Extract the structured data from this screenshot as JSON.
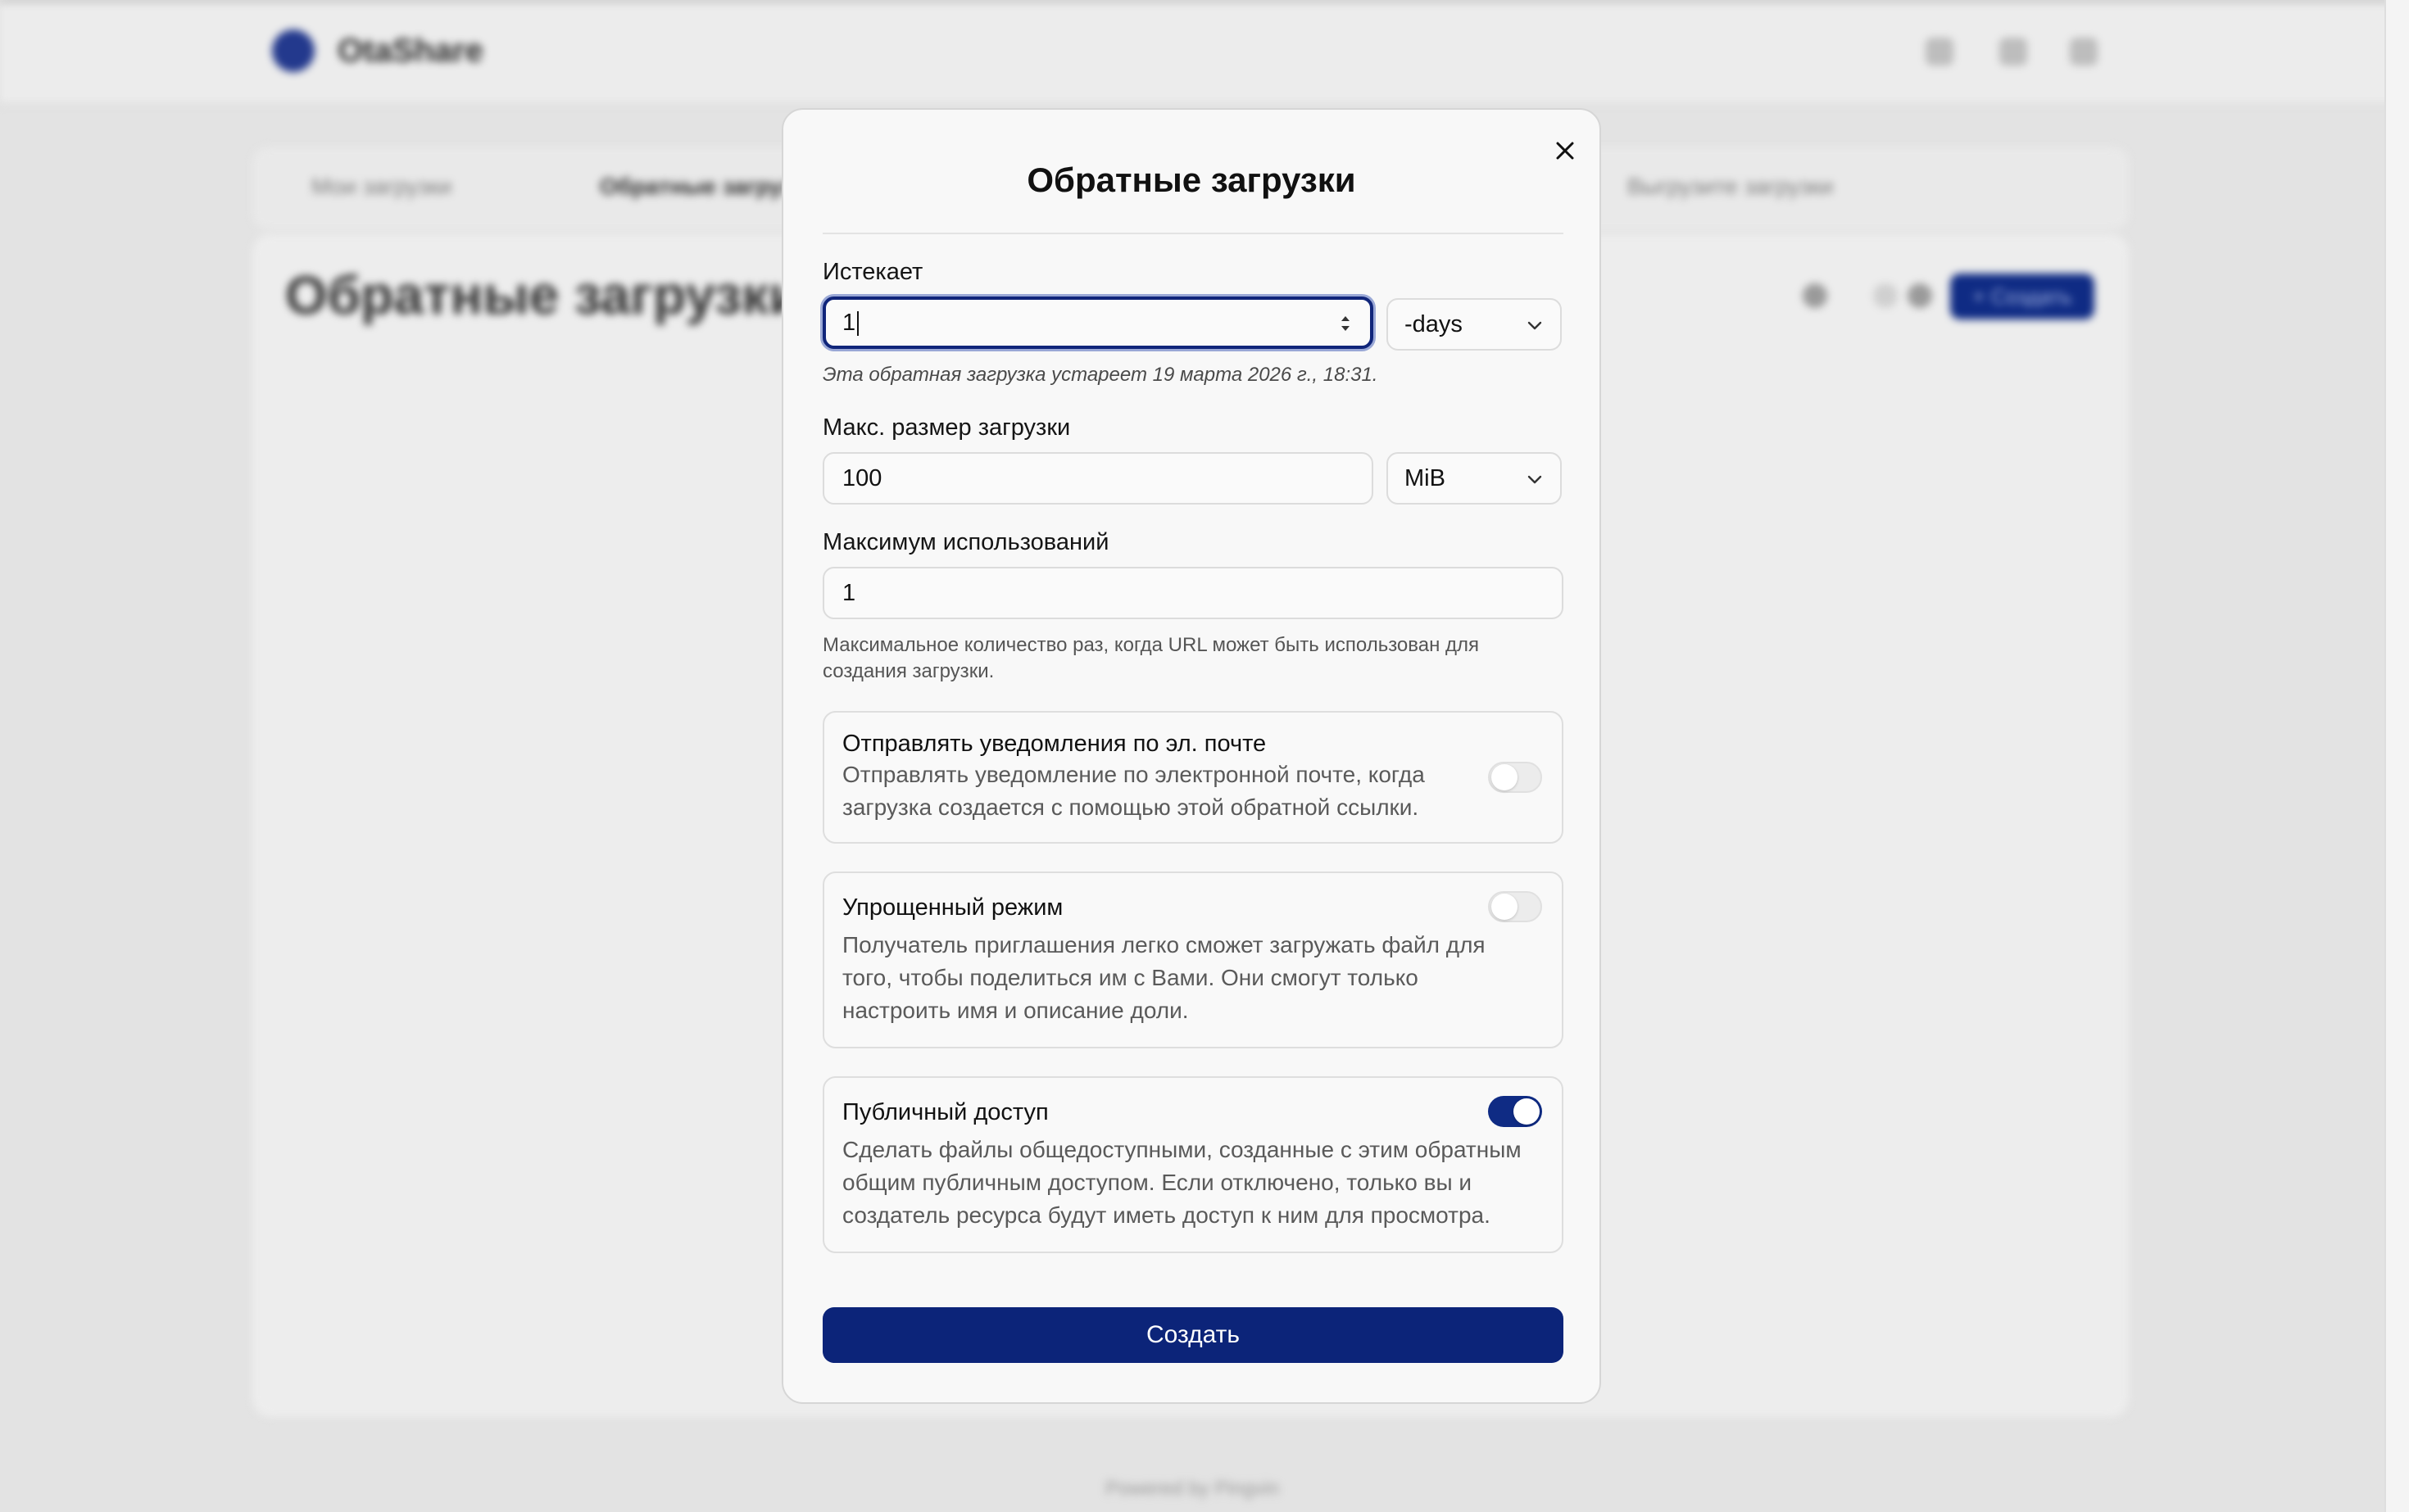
{
  "background": {
    "app_name": "OtaShare",
    "tabs": [
      "Мои загрузки",
      "Обратные загрузки",
      "Выгрузите загрузки"
    ],
    "page_title": "Обратные загрузки",
    "create_button": "+ Создать",
    "footer": "Powered by Pingvin"
  },
  "modal": {
    "title": "Обратные загрузки",
    "expires": {
      "label": "Истекает",
      "value": "1",
      "unit": "-days",
      "hint": "Эта обратная загрузка устарeет 19 марта 2026 г., 18:31."
    },
    "max_size": {
      "label": "Макс. размер загрузки",
      "value": "100",
      "unit": "MiB"
    },
    "max_uses": {
      "label": "Максимум использований",
      "value": "1",
      "hint_line1": "Максимальное количество раз, когда URL может быть использован для",
      "hint_line2": "создания загрузки."
    },
    "email_notify": {
      "title": "Отправлять уведомления по эл. почте",
      "desc_line1": "Отправлять уведомление по электронной почте, когда",
      "desc_line2": "загрузка создается с помощью этой обратной ссылки.",
      "enabled": false
    },
    "simple_mode": {
      "title": "Упрощенный режим",
      "desc_line1": "Получатель приглашения легко сможет загружать файл для",
      "desc_line2": "того, чтобы поделиться им с Вами. Они смогут только",
      "desc_line3": "настроить имя и описание доли.",
      "enabled": false
    },
    "public_access": {
      "title": "Публичный доступ",
      "desc_line1": "Сделать файлы общедоступными, созданные с этим обратным",
      "desc_line2": "общим публичным доступом. Если отключено, только вы и",
      "desc_line3": "создатель ресурса будут иметь доступ к ним для просмотра.",
      "enabled": true
    },
    "submit_label": "Создать"
  },
  "colors": {
    "accent": "#0c2479",
    "backdrop": "#e3e3e3",
    "modal_bg": "#f8f8f8"
  }
}
